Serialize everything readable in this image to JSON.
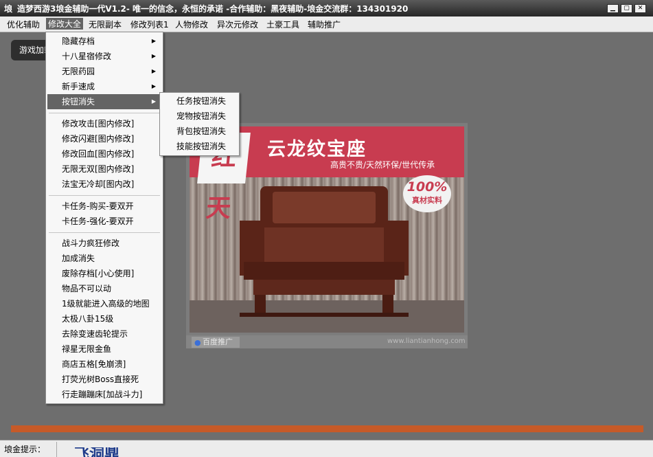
{
  "title_bar": {
    "icon_text": "埌",
    "title": "造梦西游3埌金辅助一代V1.2- 唯一的信念，永恒的承诺 -合作辅助：黑夜辅助-埌金交流群：134301920",
    "minimize_glyph": "▁",
    "maximize_glyph": "▢",
    "close_glyph": "✕"
  },
  "menubar": {
    "items": [
      "优化辅助",
      "修改大全",
      "无限副本",
      "修改列表1",
      "人物修改",
      "异次元修改",
      "土豪工具",
      "辅助推广"
    ],
    "active_index": 1
  },
  "main": {
    "game_button_label": "游戏加载"
  },
  "dropdown": {
    "items": [
      {
        "label": "隐藏存档",
        "submenu": true
      },
      {
        "label": "十八星宿修改",
        "submenu": true
      },
      {
        "label": "无限药园",
        "submenu": true
      },
      {
        "label": "新手速成",
        "submenu": true
      },
      {
        "label": "按钮消失",
        "submenu": true,
        "highlighted": true
      },
      {
        "separator": true
      },
      {
        "label": "修改攻击[图内修改]"
      },
      {
        "label": "修改闪避[图内修改]"
      },
      {
        "label": "修改回血[图内修改]"
      },
      {
        "label": "无限无双[图内修改]"
      },
      {
        "label": "法宝无冷却[图内改]"
      },
      {
        "separator": true
      },
      {
        "label": "卡任务-购买-要双开"
      },
      {
        "label": "卡任务-强化-要双开"
      },
      {
        "separator": true
      },
      {
        "label": "战斗力疯狂修改"
      },
      {
        "label": "加成消失"
      },
      {
        "label": "废除存档[小心使用]"
      },
      {
        "label": "物品不可以动"
      },
      {
        "label": "1级就能进入高级的地图"
      },
      {
        "label": "太极八卦15级"
      },
      {
        "label": "去除变速齿轮提示"
      },
      {
        "label": "禄星无限金鱼"
      },
      {
        "label": "商店五格[免崩溃]"
      },
      {
        "label": "打荧光树Boss直接死"
      },
      {
        "label": "行走蹦蹦床[加战斗力]"
      }
    ]
  },
  "submenu": {
    "items": [
      "任务按钮消失",
      "宠物按钮消失",
      "背包按钮消失",
      "技能按钮消失"
    ]
  },
  "ad": {
    "calligraphy": "红天",
    "title": "云龙纹宝座",
    "subtitle": "高贵不贵/天然环保/世代传承",
    "badge_percent": "100%",
    "badge_text": "真材实料",
    "baidu_label": "百度推广",
    "url": "www.liantianhong.com",
    "colors": {
      "banner_red": "#c83c50"
    }
  },
  "progress": {
    "value": 1.0,
    "color": "#c65a28"
  },
  "status": {
    "label": "埌金提示：",
    "graphic_text": "飞洞鼎"
  }
}
